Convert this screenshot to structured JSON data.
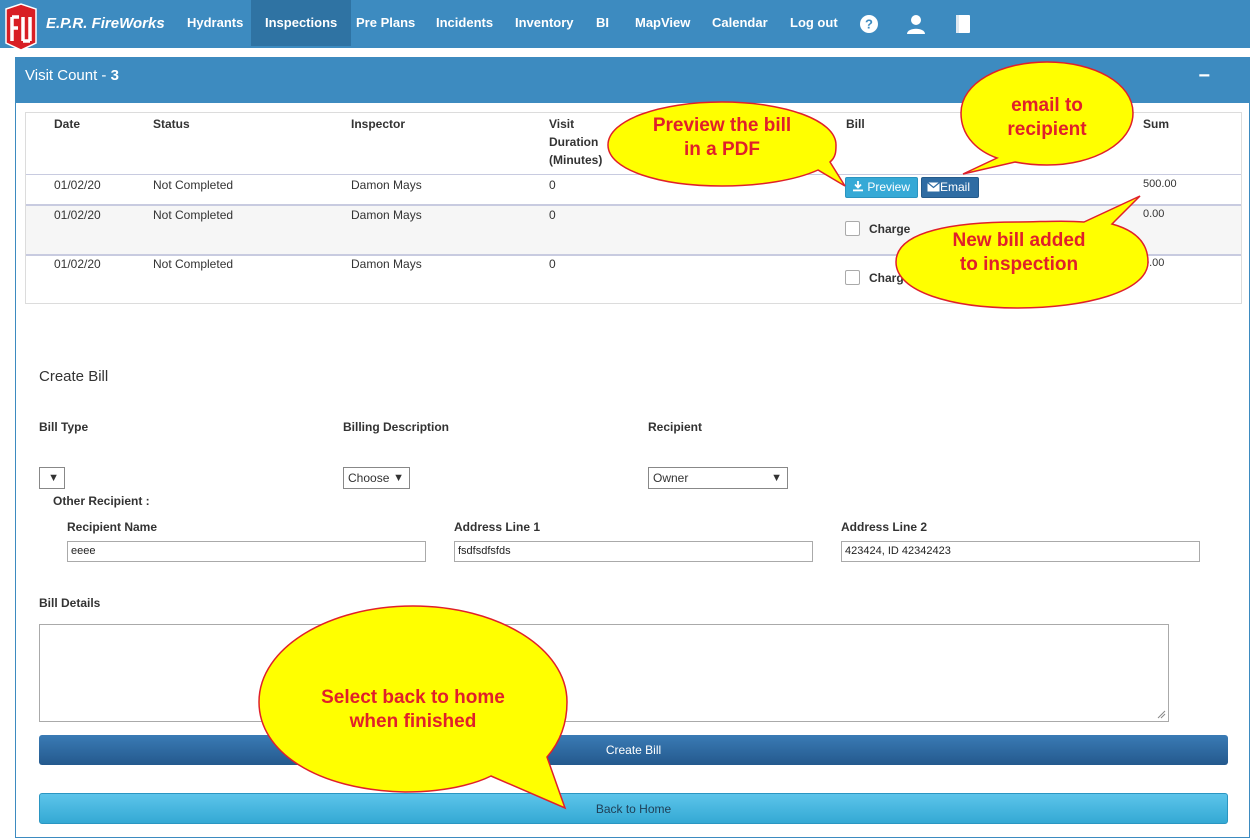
{
  "app": {
    "brand": "E.P.R. FireWorks"
  },
  "nav": {
    "items": [
      "Hydrants",
      "Inspections",
      "Pre Plans",
      "Incidents",
      "Inventory",
      "BI",
      "MapView",
      "Calendar",
      "Log out"
    ],
    "active": "Inspections",
    "icons": [
      "help-icon",
      "user-icon",
      "book-icon"
    ]
  },
  "panel": {
    "title_prefix": "Visit Count - ",
    "count": "3",
    "collapse": "−"
  },
  "table": {
    "headers": {
      "date": "Date",
      "status": "Status",
      "inspector": "Inspector",
      "duration": "Visit Duration (Minutes)",
      "bill": "Bill",
      "sum": "Sum"
    },
    "rows": [
      {
        "date": "01/02/20",
        "status": "Not Completed",
        "inspector": "Damon Mays",
        "duration": "0",
        "sum": "500.00"
      },
      {
        "date": "01/02/20",
        "status": "Not Completed",
        "inspector": "Damon Mays",
        "duration": "0",
        "bill": "Charge",
        "sum": "0.00"
      },
      {
        "date": "01/02/20",
        "status": "Not Completed",
        "inspector": "Damon Mays",
        "duration": "0",
        "bill": "Charge",
        "sum": "0.00"
      }
    ],
    "preview_label": "Preview",
    "email_label": "Email"
  },
  "form": {
    "heading": "Create Bill",
    "bill_type_label": "Bill Type",
    "billing_description_label": "Billing Description",
    "billing_description_value": "Choose",
    "recipient_label": "Recipient",
    "recipient_value": "Owner",
    "other_recipient_label": "Other Recipient :",
    "recipient_name_label": "Recipient Name",
    "recipient_name_value": "eeee",
    "address1_label": "Address Line 1",
    "address1_value": "fsdfsdfsfds",
    "address2_label": "Address Line 2",
    "address2_value": "423424, ID 42342423",
    "bill_details_label": "Bill Details",
    "create_button": "Create Bill",
    "home_button": "Back to Home"
  },
  "callouts": {
    "preview": [
      "Preview the bill",
      "in a PDF"
    ],
    "email": [
      "email to",
      "recipient"
    ],
    "new_bill": [
      "New bill added",
      "to inspection"
    ],
    "home": [
      "Select back to home",
      "when finished"
    ]
  },
  "colors": {
    "nav": "#3d8bc0",
    "callout_fill": "#ffff00",
    "callout_border": "#e0202a",
    "callout_text": "#e0202a"
  }
}
